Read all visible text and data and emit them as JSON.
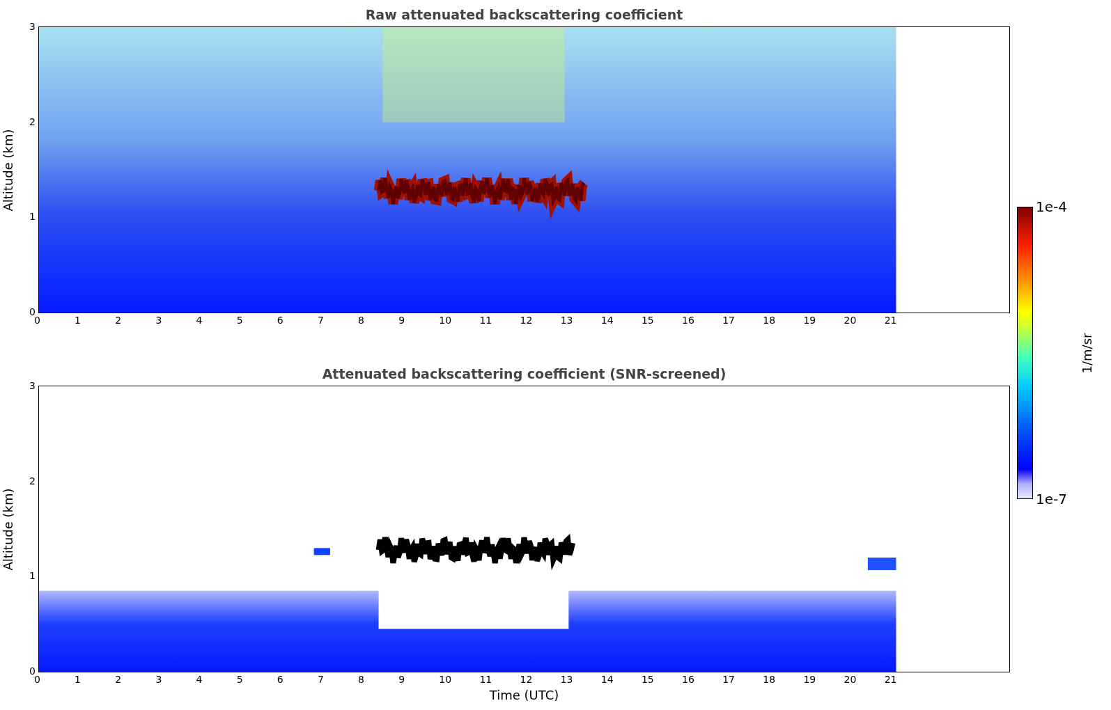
{
  "panels": [
    {
      "kind": "raw",
      "title": "Raw attenuated backscattering coefficient",
      "ylabel": "Altitude (km)",
      "yticks": [
        "3",
        "2",
        "1",
        "0"
      ],
      "xticks": [
        "0",
        "1",
        "2",
        "3",
        "4",
        "5",
        "6",
        "7",
        "8",
        "9",
        "10",
        "11",
        "12",
        "13",
        "14",
        "15",
        "16",
        "17",
        "18",
        "19",
        "20",
        "21"
      ]
    },
    {
      "kind": "screened",
      "title": "Attenuated backscattering coefficient (SNR-screened)",
      "ylabel": "Altitude (km)",
      "yticks": [
        "3",
        "2",
        "1",
        "0"
      ],
      "xticks": [
        "0",
        "1",
        "2",
        "3",
        "4",
        "5",
        "6",
        "7",
        "8",
        "9",
        "10",
        "11",
        "12",
        "13",
        "14",
        "15",
        "16",
        "17",
        "18",
        "19",
        "20",
        "21"
      ],
      "xlabel": "Time (UTC)"
    }
  ],
  "colorbar": {
    "label": "1/m/sr",
    "max": "1e-4",
    "min": "1e-7"
  }
}
